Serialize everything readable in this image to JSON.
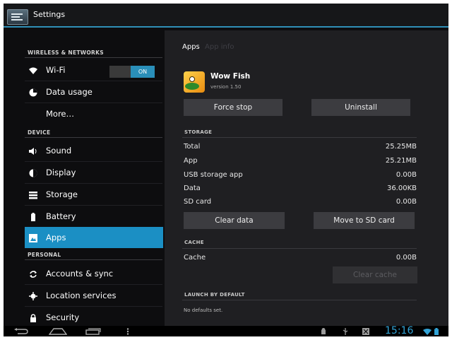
{
  "action_bar": {
    "title": "Settings",
    "accent": "#2f8fb7"
  },
  "left_pane": {
    "sections": [
      {
        "header": "WIRELESS & NETWORKS",
        "items": [
          {
            "label": "Wi-Fi",
            "icon": "wifi-icon",
            "toggle": "ON"
          },
          {
            "label": "Data usage",
            "icon": "data-usage-icon"
          },
          {
            "label": "More…",
            "icon": ""
          }
        ]
      },
      {
        "header": "DEVICE",
        "items": [
          {
            "label": "Sound",
            "icon": "speaker-icon"
          },
          {
            "label": "Display",
            "icon": "display-icon"
          },
          {
            "label": "Storage",
            "icon": "storage-icon"
          },
          {
            "label": "Battery",
            "icon": "battery-icon"
          },
          {
            "label": "Apps",
            "icon": "apps-icon",
            "selected": true
          }
        ]
      },
      {
        "header": "PERSONAL",
        "items": [
          {
            "label": "Accounts & sync",
            "icon": "sync-icon"
          },
          {
            "label": "Location services",
            "icon": "location-icon"
          },
          {
            "label": "Security",
            "icon": "lock-icon"
          }
        ]
      }
    ],
    "selected_color": "#1b8fc4"
  },
  "detail": {
    "breadcrumb": {
      "current": "Apps",
      "child": "App info"
    },
    "app": {
      "name": "Wow Fish",
      "version": "version 1.50",
      "icon": "wow-fish-app-icon"
    },
    "buttons": {
      "force_stop": "Force stop",
      "uninstall": "Uninstall"
    },
    "storage": {
      "header": "STORAGE",
      "rows": [
        {
          "label": "Total",
          "value": "25.25MB"
        },
        {
          "label": "App",
          "value": "25.21MB"
        },
        {
          "label": "USB storage app",
          "value": "0.00B"
        },
        {
          "label": "Data",
          "value": "36.00KB"
        },
        {
          "label": "SD card",
          "value": "0.00B"
        }
      ],
      "clear_data": "Clear data",
      "move_to_sd": "Move to SD card"
    },
    "cache": {
      "header": "CACHE",
      "row": {
        "label": "Cache",
        "value": "0.00B"
      },
      "clear_cache": "Clear cache"
    },
    "launch": {
      "header": "LAUNCH BY DEFAULT",
      "text": "No defaults set."
    }
  },
  "nav_bar": {
    "clock": "15:16",
    "buttons": [
      "back-icon",
      "home-icon",
      "recent-apps-icon",
      "menu-icon"
    ],
    "status_icons": [
      "android-debug-icon",
      "usb-icon",
      "notification-icon",
      "wifi-status-icon",
      "battery-status-icon"
    ],
    "clock_color": "#32a3d6"
  }
}
